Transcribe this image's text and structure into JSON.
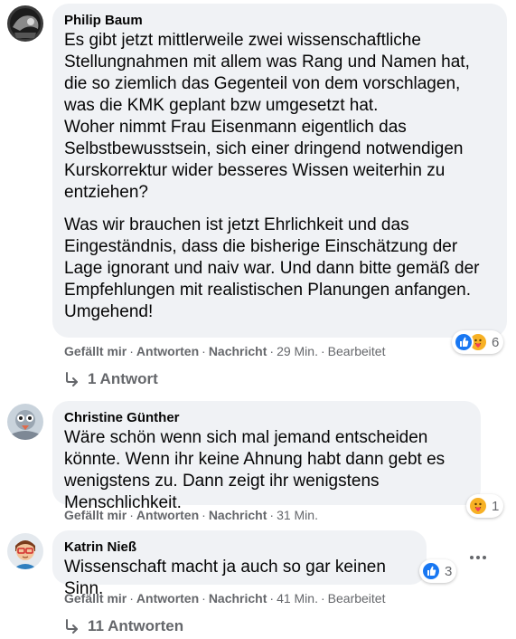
{
  "comments": [
    {
      "author": "Philip Baum",
      "paragraphs": [
        "Es gibt jetzt mittlerweile zwei wissenschaftliche Stellungnahmen mit allem was Rang und Namen hat, die so ziemlich das Gegenteil von dem vorschlagen, was die KMK geplant bzw umgesetzt hat.\nWoher nimmt Frau Eisenmann eigentlich das Selbstbewusstsein, sich einer dringend notwendigen Kurskorrektur wider besseres Wissen weiterhin zu entziehen?",
        "Was wir brauchen ist jetzt Ehrlichkeit und das Eingeständnis, dass die bisherige Einschätzung der Lage ignorant und naiv war. Und dann bitte gemäß der Empfehlungen mit realistischen Planungen anfangen. Umgehend!"
      ],
      "actions": {
        "like": "Gefällt mir",
        "reply": "Antworten",
        "message": "Nachricht",
        "time": "29 Min.",
        "edited": "Bearbeitet"
      },
      "reactions": {
        "icons": [
          "like-icon",
          "care-icon"
        ],
        "count": "6"
      },
      "replies": "1 Antwort"
    },
    {
      "author": "Christine Günther",
      "paragraphs": [
        "Wäre schön wenn sich mal jemand entscheiden könnte. Wenn ihr keine Ahnung habt dann gebt es wenigstens zu. Dann zeigt ihr wenigstens Menschlichkeit."
      ],
      "actions": {
        "like": "Gefällt mir",
        "reply": "Antworten",
        "message": "Nachricht",
        "time": "31 Min."
      },
      "reactions": {
        "icons": [
          "care-icon"
        ],
        "count": "1"
      }
    },
    {
      "author": "Katrin Nieß",
      "paragraphs": [
        "Wissenschaft macht ja auch so gar keinen Sinn."
      ],
      "actions": {
        "like": "Gefällt mir",
        "reply": "Antworten",
        "message": "Nachricht",
        "time": "41 Min.",
        "edited": "Bearbeitet"
      },
      "reactions": {
        "icons": [
          "like-icon"
        ],
        "count": "3"
      },
      "replies": "11 Antworten",
      "more": "more-options-icon"
    }
  ],
  "colors": {
    "bubble": "#f0f2f5",
    "secondary_text": "#65676b",
    "like_blue": "#1877f2",
    "care_yellow": "#f7b125"
  }
}
